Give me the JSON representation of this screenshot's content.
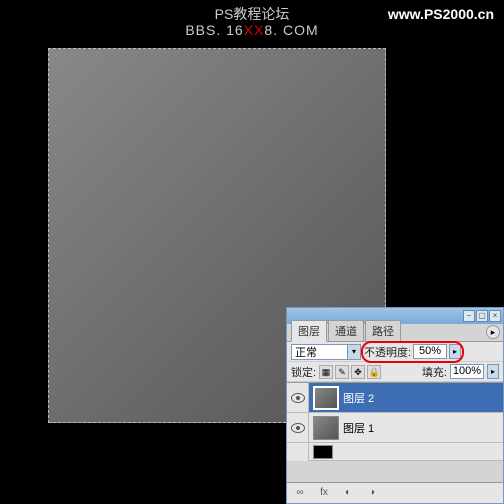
{
  "header": {
    "title": "PS教程论坛",
    "subtitle_prefix": "BBS. 16",
    "subtitle_red": "XX",
    "subtitle_suffix": "8. COM",
    "watermark": "www.PS2000.cn"
  },
  "panel": {
    "tabs": {
      "layers": "图层",
      "channels": "通道",
      "paths": "路径"
    },
    "blend_mode": "正常",
    "opacity": {
      "label": "不透明度:",
      "value": "50%"
    },
    "lock": {
      "label": "锁定:"
    },
    "fill": {
      "label": "填充:",
      "value": "100%"
    },
    "layers": [
      {
        "name": "图层 2",
        "selected": true
      },
      {
        "name": "图层 1",
        "selected": false
      }
    ]
  }
}
